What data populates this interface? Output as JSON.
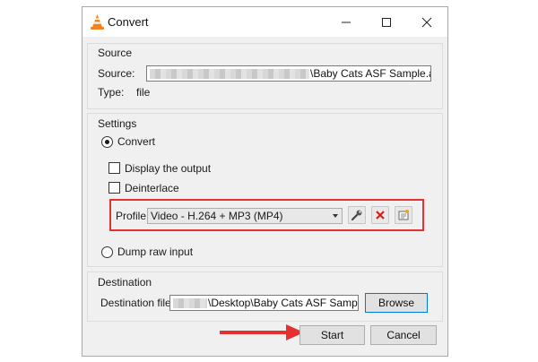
{
  "window": {
    "title": "Convert",
    "controls": [
      "minimize",
      "maximize",
      "close"
    ]
  },
  "source": {
    "group_title": "Source",
    "source_label": "Source:",
    "source_value": "\\Baby Cats ASF Sample.asf",
    "type_label": "Type:",
    "type_value": "file"
  },
  "settings": {
    "group_title": "Settings",
    "convert_label": "Convert",
    "convert_selected": true,
    "display_output_label": "Display the output",
    "display_output_checked": false,
    "deinterlace_label": "Deinterlace",
    "deinterlace_checked": false,
    "profile_label": "Profile",
    "profile_value": "Video - H.264 + MP3 (MP4)",
    "profile_buttons": [
      "wrench-icon",
      "delete-icon",
      "new-profile-icon"
    ],
    "dump_raw_label": "Dump raw input",
    "dump_raw_selected": false
  },
  "destination": {
    "group_title": "Destination",
    "file_label": "Destination file:",
    "file_value": "\\Desktop\\Baby Cats ASF Sample.asf",
    "browse_label": "Browse"
  },
  "footer": {
    "start_label": "Start",
    "cancel_label": "Cancel"
  },
  "colors": {
    "highlight": "#e53030",
    "arrow": "#e53030",
    "focus_border": "#0078d7",
    "vlc_orange": "#f58220"
  }
}
